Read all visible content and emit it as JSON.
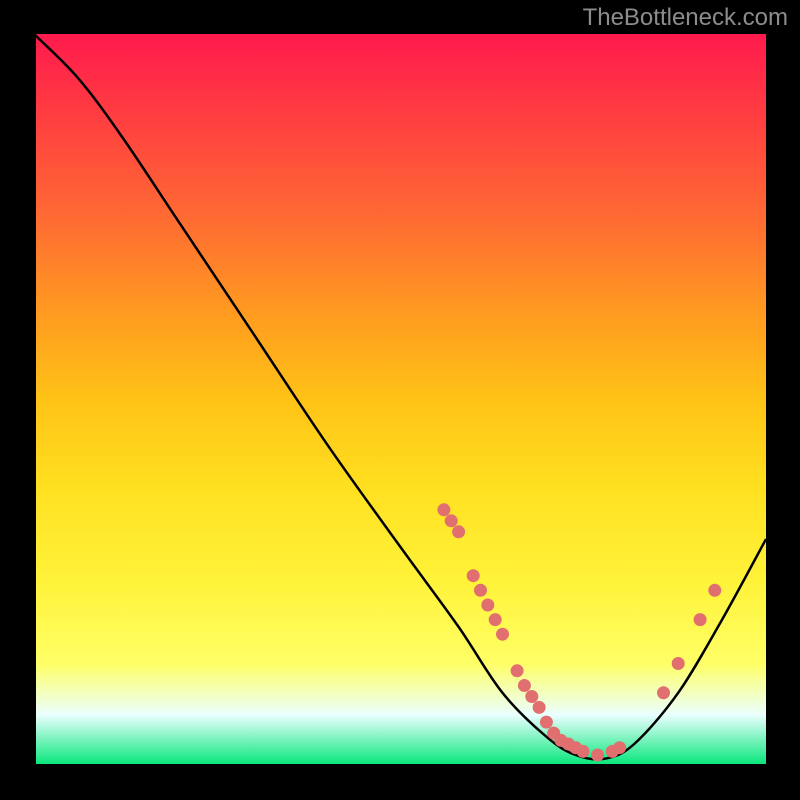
{
  "watermark": "TheBottleneck.com",
  "chart_data": {
    "type": "line",
    "title": "",
    "xlabel": "",
    "ylabel": "",
    "xlim": [
      0,
      100
    ],
    "ylim": [
      0,
      100
    ],
    "series": [
      {
        "name": "bottleneck-curve",
        "points": [
          {
            "x": 0,
            "y": 100
          },
          {
            "x": 6,
            "y": 94
          },
          {
            "x": 12,
            "y": 86
          },
          {
            "x": 20,
            "y": 74
          },
          {
            "x": 30,
            "y": 59
          },
          {
            "x": 40,
            "y": 44
          },
          {
            "x": 50,
            "y": 30
          },
          {
            "x": 58,
            "y": 19
          },
          {
            "x": 64,
            "y": 10
          },
          {
            "x": 70,
            "y": 4
          },
          {
            "x": 74,
            "y": 1.5
          },
          {
            "x": 78,
            "y": 1
          },
          {
            "x": 82,
            "y": 3
          },
          {
            "x": 88,
            "y": 10
          },
          {
            "x": 94,
            "y": 20
          },
          {
            "x": 100,
            "y": 31
          }
        ]
      }
    ],
    "markers": [
      {
        "x": 56,
        "y": 35
      },
      {
        "x": 57,
        "y": 33.5
      },
      {
        "x": 58,
        "y": 32
      },
      {
        "x": 60,
        "y": 26
      },
      {
        "x": 61,
        "y": 24
      },
      {
        "x": 62,
        "y": 22
      },
      {
        "x": 63,
        "y": 20
      },
      {
        "x": 64,
        "y": 18
      },
      {
        "x": 66,
        "y": 13
      },
      {
        "x": 67,
        "y": 11
      },
      {
        "x": 68,
        "y": 9.5
      },
      {
        "x": 69,
        "y": 8
      },
      {
        "x": 70,
        "y": 6
      },
      {
        "x": 71,
        "y": 4.5
      },
      {
        "x": 72,
        "y": 3.5
      },
      {
        "x": 73,
        "y": 3
      },
      {
        "x": 74,
        "y": 2.5
      },
      {
        "x": 75,
        "y": 2
      },
      {
        "x": 77,
        "y": 1.5
      },
      {
        "x": 79,
        "y": 2
      },
      {
        "x": 80,
        "y": 2.5
      },
      {
        "x": 86,
        "y": 10
      },
      {
        "x": 88,
        "y": 14
      },
      {
        "x": 91,
        "y": 20
      },
      {
        "x": 93,
        "y": 24
      }
    ],
    "legend": null,
    "grid": false,
    "marker_color": "#e16f6f",
    "line_color": "#000000",
    "background_gradient": [
      "#ff1a4d",
      "#ffc316",
      "#ffff66",
      "#00e676"
    ]
  }
}
